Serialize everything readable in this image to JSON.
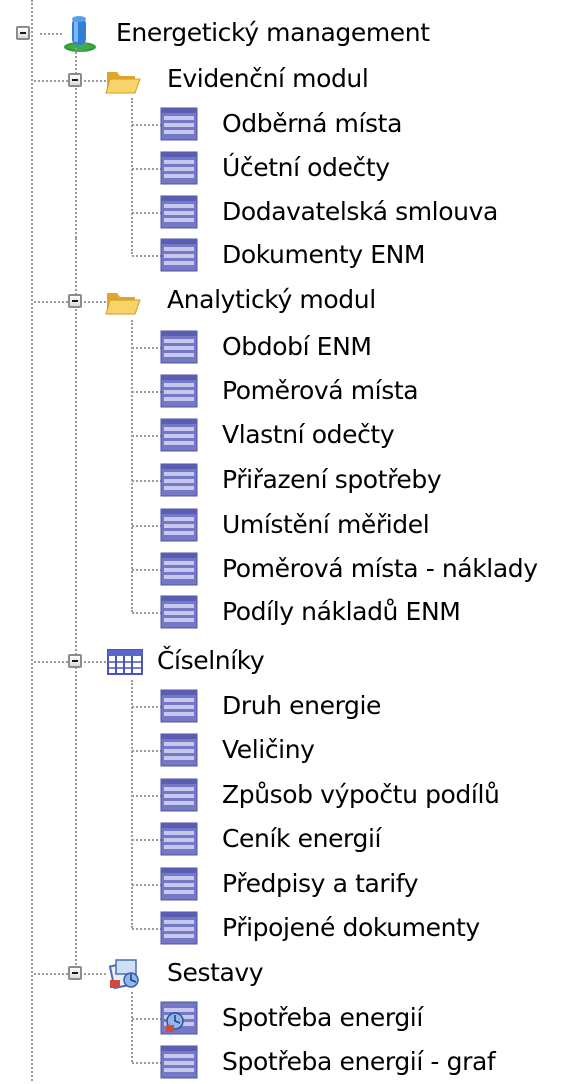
{
  "tree": {
    "root": {
      "label": "Energetický management",
      "icon": "energy-management-icon",
      "expanded": true
    },
    "groups": [
      {
        "key": "evidencni",
        "label": "Evidenční modul",
        "icon": "folder-open-icon",
        "expanded": true,
        "items": [
          {
            "label": "Odběrná místa",
            "icon": "form-icon"
          },
          {
            "label": "Účetní odečty",
            "icon": "form-icon"
          },
          {
            "label": "Dodavatelská smlouva",
            "icon": "form-icon"
          },
          {
            "label": "Dokumenty ENM",
            "icon": "form-icon"
          }
        ]
      },
      {
        "key": "analyticky",
        "label": "Analytický modul",
        "icon": "folder-open-icon",
        "expanded": true,
        "items": [
          {
            "label": "Období ENM",
            "icon": "form-icon"
          },
          {
            "label": "Poměrová místa",
            "icon": "form-icon"
          },
          {
            "label": "Vlastní odečty",
            "icon": "form-icon"
          },
          {
            "label": "Přiřazení spotřeby",
            "icon": "form-icon"
          },
          {
            "label": "Umístění měřidel",
            "icon": "form-icon"
          },
          {
            "label": "Poměrová místa - náklady",
            "icon": "form-icon"
          },
          {
            "label": "Podíly nákladů ENM",
            "icon": "form-icon"
          }
        ]
      },
      {
        "key": "ciselniky",
        "label": "Číselníky",
        "icon": "table-grid-icon",
        "expanded": true,
        "items": [
          {
            "label": "Druh energie",
            "icon": "form-icon"
          },
          {
            "label": "Veličiny",
            "icon": "form-icon"
          },
          {
            "label": "Způsob výpočtu podílů",
            "icon": "form-icon"
          },
          {
            "label": "Ceník energií",
            "icon": "form-icon"
          },
          {
            "label": "Předpisy a tarify",
            "icon": "form-icon"
          },
          {
            "label": "Připojené dokumenty",
            "icon": "form-icon"
          }
        ]
      },
      {
        "key": "sestavy",
        "label": "Sestavy",
        "icon": "reports-icon",
        "expanded": true,
        "items": [
          {
            "label": "Spotřeba energií",
            "icon": "report-form-icon"
          },
          {
            "label": "Spotřeba energií - graf",
            "icon": "form-icon"
          }
        ]
      }
    ]
  },
  "colors": {
    "tree_line": "#9a9a9a",
    "form_icon_blue": "#6f74c8",
    "folder_yellow": "#f2c24a",
    "root_icon_blue": "#2f7fd6",
    "root_icon_green": "#2f9a3a"
  }
}
